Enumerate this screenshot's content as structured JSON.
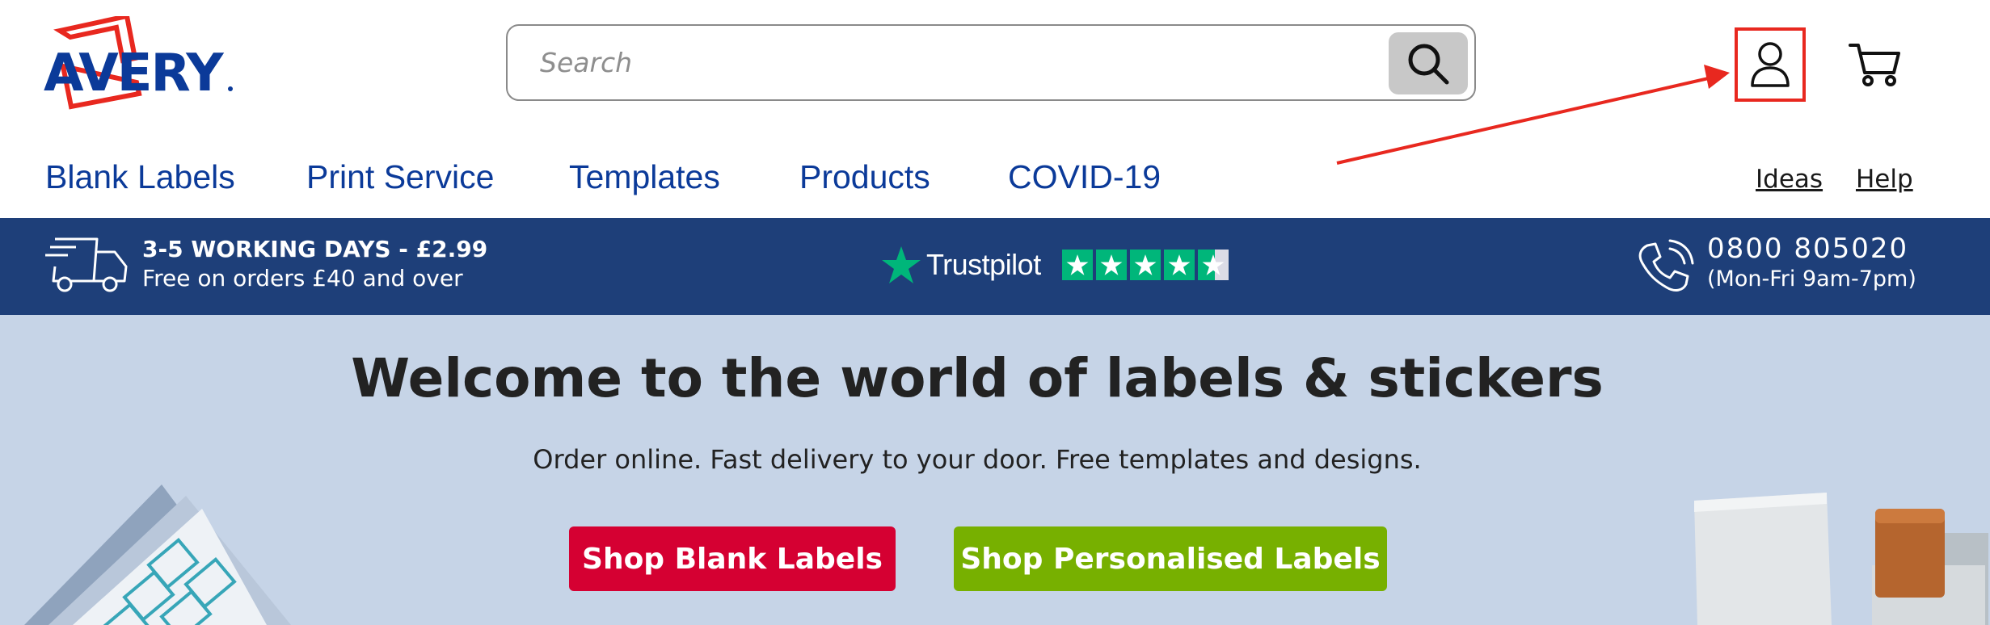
{
  "brand": {
    "name": "AVERY",
    "logo_color": "#0b3a99",
    "frame_color": "#e8281f"
  },
  "search": {
    "placeholder": "Search",
    "value": ""
  },
  "header_actions": {
    "account_icon": "user-icon",
    "cart_icon": "cart-icon",
    "highlight_color": "#e8281f"
  },
  "nav": {
    "main_items": [
      {
        "label": "Blank Labels"
      },
      {
        "label": "Print Service"
      },
      {
        "label": "Templates"
      },
      {
        "label": "Products"
      },
      {
        "label": "COVID-19"
      }
    ],
    "secondary_items": [
      {
        "label": "Ideas"
      },
      {
        "label": "Help"
      }
    ]
  },
  "info_bar": {
    "delivery_title": "3-5 WORKING DAYS - £2.99",
    "delivery_subtitle": "Free on orders £40 and over",
    "trustpilot_label": "Trustpilot",
    "trustpilot_rating": 4.5,
    "phone_number": "0800  805020",
    "phone_hours": "(Mon-Fri  9am-7pm)",
    "background_color": "#1e3f79"
  },
  "hero": {
    "title": "Welcome to the world of labels & stickers",
    "subtitle": "Order online. Fast delivery to your door. Free templates and designs.",
    "buttons": [
      {
        "label": "Shop Blank Labels",
        "color": "#d50032"
      },
      {
        "label": "Shop Personalised Labels",
        "color": "#77b000"
      }
    ],
    "background_color": "#c6d4e7"
  }
}
